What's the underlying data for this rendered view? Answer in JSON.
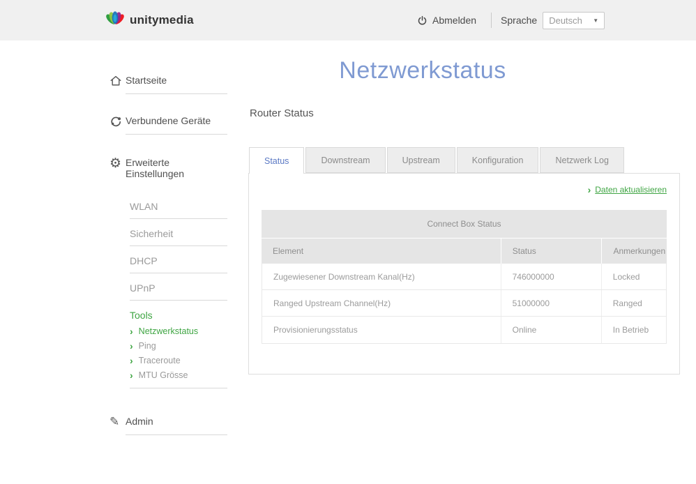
{
  "header": {
    "brand": "unitymedia",
    "logout_label": "Abmelden",
    "language_label": "Sprache",
    "language_value": "Deutsch"
  },
  "sidebar": {
    "items": [
      {
        "icon": "home-icon",
        "label": "Startseite"
      },
      {
        "icon": "devices-icon",
        "label": "Verbundene Geräte"
      },
      {
        "icon": "gear-icon",
        "label": "Erweiterte Einstellungen"
      },
      {
        "icon": "pencil-icon",
        "label": "Admin"
      }
    ],
    "advanced_subitems": [
      "WLAN",
      "Sicherheit",
      "DHCP",
      "UPnP"
    ],
    "tools": {
      "label": "Tools",
      "items": [
        "Netzwerkstatus",
        "Ping",
        "Traceroute",
        "MTU Grösse"
      ],
      "active": "Netzwerkstatus"
    }
  },
  "main": {
    "page_title": "Netzwerkstatus",
    "section_title": "Router Status",
    "tabs": [
      "Status",
      "Downstream",
      "Upstream",
      "Konfiguration",
      "Netzwerk Log"
    ],
    "active_tab": "Status",
    "refresh_link": "Daten aktualisieren",
    "table": {
      "caption": "Connect Box Status",
      "columns": [
        "Element",
        "Status",
        "Anmerkungen"
      ],
      "rows": [
        [
          "Zugewiesener Downstream Kanal(Hz)",
          "746000000",
          "Locked"
        ],
        [
          "Ranged Upstream Channel(Hz)",
          "51000000",
          "Ranged"
        ],
        [
          "Provisionierungsstatus",
          "Online",
          "In Betrieb"
        ]
      ]
    }
  },
  "colors": {
    "accent_green": "#3FA543",
    "title_blue": "#7F9AD2",
    "header_bg": "#F0F0F0"
  }
}
